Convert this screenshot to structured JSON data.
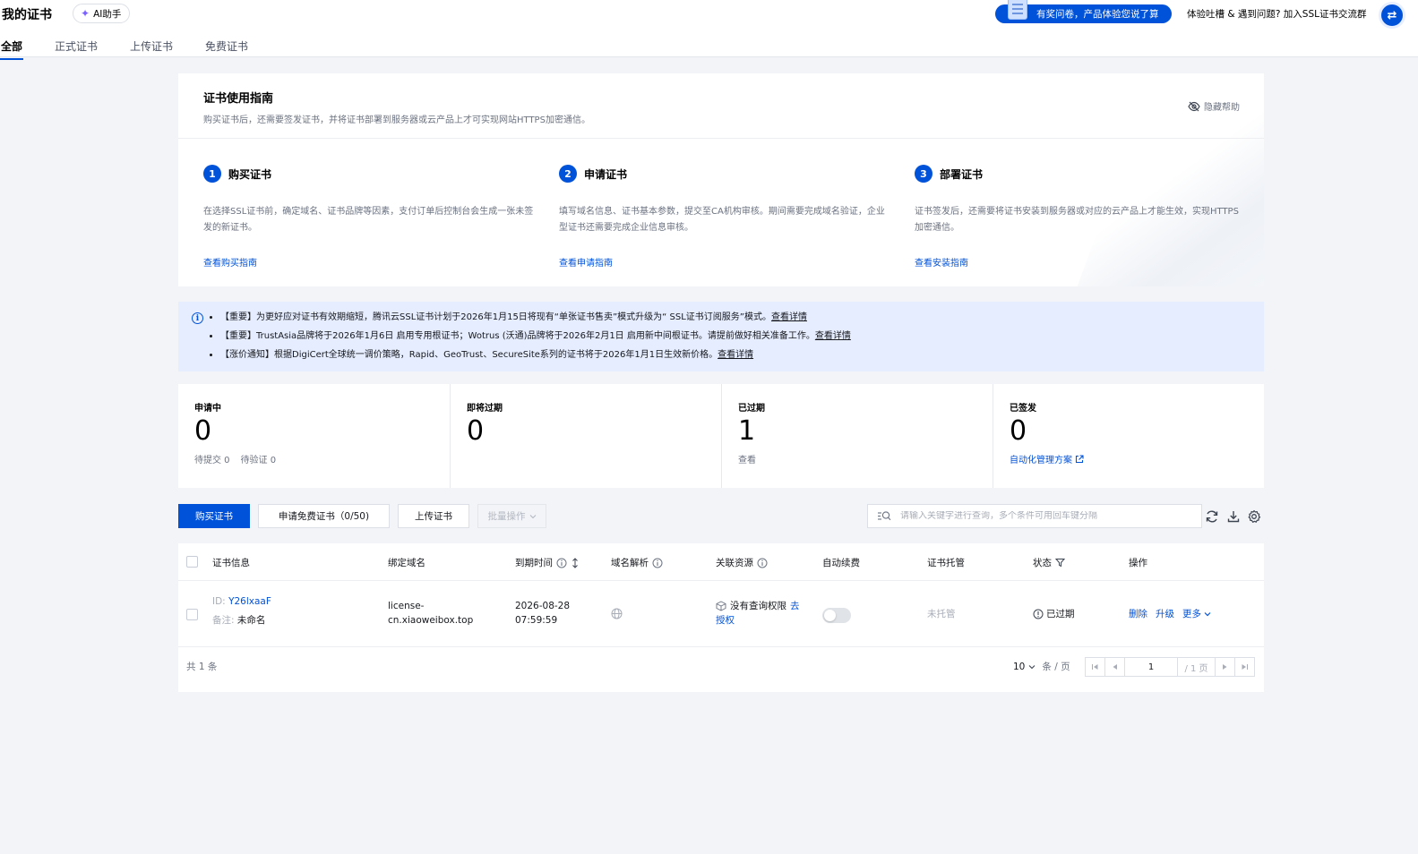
{
  "header": {
    "title": "我的证书",
    "ai_label": "AI助手",
    "survey_label": "有奖问卷，产品体验您说了算",
    "feedback": "体验吐槽 & 遇到问题? 加入SSL证书交流群",
    "tabs": [
      {
        "label": "全部"
      },
      {
        "label": "正式证书"
      },
      {
        "label": "上传证书"
      },
      {
        "label": "免费证书"
      }
    ]
  },
  "guide": {
    "title": "证书使用指南",
    "subtitle": "购买证书后，还需要签发证书，并将证书部署到服务器或云产品上才可实现网站HTTPS加密通信。",
    "hide_help": "隐藏帮助",
    "steps": [
      {
        "num": "1",
        "title": "购买证书",
        "desc": "在选择SSL证书前，确定域名、证书品牌等因素，支付订单后控制台会生成一张未签发的新证书。",
        "link": "查看购买指南"
      },
      {
        "num": "2",
        "title": "申请证书",
        "desc": "填写域名信息、证书基本参数，提交至CA机构审核。期间需要完成域名验证，企业型证书还需要完成企业信息审核。",
        "link": "查看申请指南"
      },
      {
        "num": "3",
        "title": "部署证书",
        "desc": "证书签发后，还需要将证书安装到服务器或对应的云产品上才能生效，实现HTTPS加密通信。",
        "link": "查看安装指南"
      }
    ]
  },
  "notices": [
    {
      "text": "【重要】为更好应对证书有效期缩短，腾讯云SSL证书计划于2026年1月15日将现有“单张证书售卖”模式升级为“ SSL证书订阅服务”模式。",
      "link": "查看详情"
    },
    {
      "text": "【重要】TrustAsia品牌将于2026年1月6日 启用专用根证书；Wotrus (沃通)品牌将于2026年2月1日 启用新中间根证书。请提前做好相关准备工作。",
      "link": "查看详情"
    },
    {
      "text": "【涨价通知】根据DigiCert全球统一调价策略，Rapid、GeoTrust、SecureSite系列的证书将于2026年1月1日生效新价格。",
      "link": "查看详情"
    }
  ],
  "stats": [
    {
      "label": "申请中",
      "value": "0",
      "sub1": "待提交 0",
      "sub2": "待验证 0"
    },
    {
      "label": "即将过期",
      "value": "0"
    },
    {
      "label": "已过期",
      "value": "1",
      "sub1": "查看"
    },
    {
      "label": "已签发",
      "value": "0",
      "link": "自动化管理方案"
    }
  ],
  "toolbar": {
    "buy": "购买证书",
    "apply_free": "申请免费证书（0/50)",
    "upload": "上传证书",
    "batch": "批量操作",
    "search_placeholder": "请输入关键字进行查询，多个条件可用回车键分隔"
  },
  "table": {
    "columns": [
      "证书信息",
      "绑定域名",
      "到期时间",
      "域名解析",
      "关联资源",
      "自动续费",
      "证书托管",
      "状态",
      "操作"
    ],
    "rows": [
      {
        "id_label": "ID:",
        "id": "Y26lxaaF",
        "note_label": "备注:",
        "note": "未命名",
        "domain_line1": "license-",
        "domain_line2": "cn.xiaoweibox.top",
        "expire_date": "2026-08-28",
        "expire_time": "07:59:59",
        "resource": "没有查询权限",
        "resource_link1": "去",
        "resource_link2": "授权",
        "hosting": "未托管",
        "status": "已过期",
        "actions": [
          "删除",
          "升级",
          "更多"
        ]
      }
    ],
    "total": "共 1 条",
    "page_size": "10",
    "page_size_unit": "条 / 页",
    "page": "1",
    "page_total": "/ 1 页"
  }
}
